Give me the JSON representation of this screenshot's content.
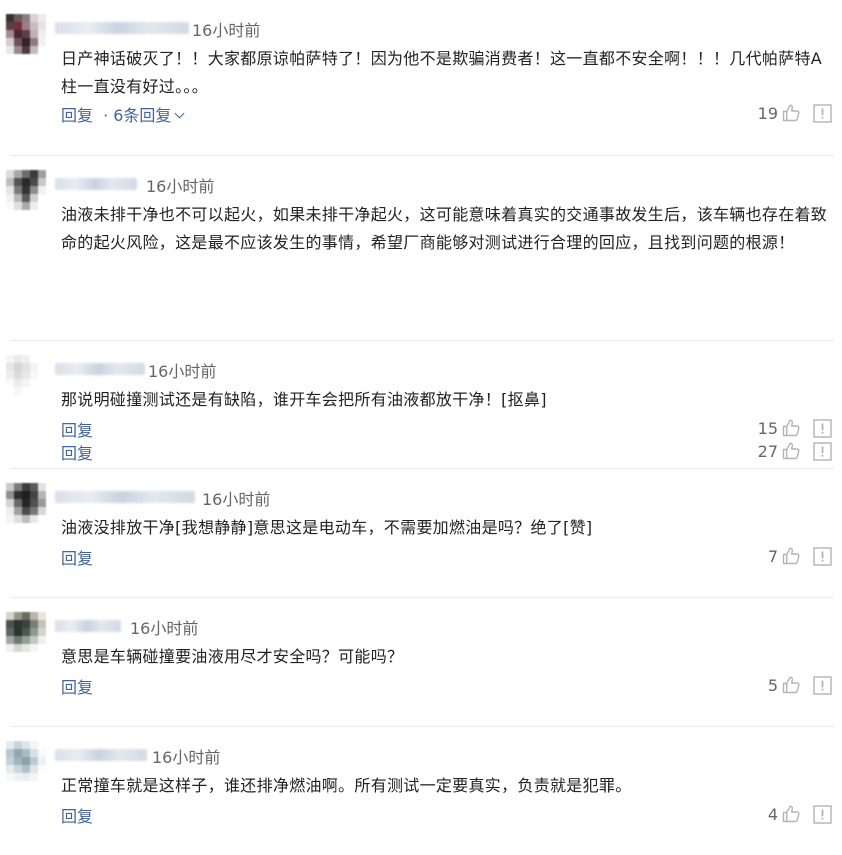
{
  "comments": [
    {
      "time": "16小时前",
      "text": "日产神话破灭了！！大家都原谅帕萨特了！因为他不是欺骗消费者！这一直都不安全啊！！！几代帕萨特A柱一直没有好过。。。",
      "reply_label": "回复",
      "replies_label": "6条回复",
      "likes": "19",
      "avatar_colors": [
        "#3a2f31",
        "#6b5a5e",
        "#8a7d80",
        "#d9d2d3",
        "#efeaeb",
        "#5e3f45",
        "#7b2b3a",
        "#9c7f86",
        "#c7bcc0",
        "#e8e2e4",
        "#a48a91",
        "#4a2830",
        "#5d4149",
        "#bfb2b6",
        "#f1eded",
        "#d8ccd0",
        "#6e5057",
        "#2f2428",
        "#8e7b80",
        "#f4f1f2",
        "#ece6e8",
        "#9b8990",
        "#503b40",
        "#c6b9bd",
        "#ffffff"
      ]
    },
    {
      "time": "16小时前",
      "text": "油液未排干净也不可以起火，如果未排干净起火，这可能意味着真实的交通事故发生后，该车辆也存在着致命的起火风险，这是最不应该发生的事情，希望厂商能够对测试进行合理的回应，且找到问题的根源！",
      "reply_label": "回复",
      "likes": "27",
      "avatar_colors": [
        "#dcdcdc",
        "#a9a9a9",
        "#6d6d6d",
        "#3c3c3c",
        "#9e9e9e",
        "#bdbdbd",
        "#555555",
        "#2a2a2a",
        "#4b4b4b",
        "#c8c8c8",
        "#e4e4e4",
        "#7a7a7a",
        "#333333",
        "#8d8d8d",
        "#f0f0f0",
        "#f2f2f2",
        "#b7b7b7",
        "#5a5a5a",
        "#d0d0d0",
        "#ffffff",
        "#fafafa",
        "#e0e0e0",
        "#aaaaaa",
        "#eeeeee",
        "#ffffff"
      ]
    },
    {
      "time": "16小时前",
      "text": "那说明碰撞测试还是有缺陷，谁开车会把所有油液都放干净！[抠鼻]",
      "reply_label": "回复",
      "likes": "15",
      "avatar_colors": [
        "#f5f5f5",
        "#eaeaea",
        "#f0f0f0",
        "#ffffff",
        "#ffffff",
        "#e6e6e6",
        "#d6d6d6",
        "#e2e2e2",
        "#f3f3f3",
        "#ffffff",
        "#eeeeee",
        "#dcdcdc",
        "#e8e8e8",
        "#f7f7f7",
        "#ffffff",
        "#fafafa",
        "#ececec",
        "#f4f4f4",
        "#ffffff",
        "#ffffff",
        "#ffffff",
        "#f6f6f6",
        "#ffffff",
        "#ffffff",
        "#ffffff"
      ]
    },
    {
      "time": "16小时前",
      "text": "油液没排放干净[我想静静]意思这是电动车，不需要加燃油是吗？绝了[赞]",
      "reply_label": "回复",
      "likes": "7",
      "avatar_colors": [
        "#c9c9c9",
        "#7c7c7c",
        "#3d3d3d",
        "#5b5b5b",
        "#e2e2e2",
        "#8f8f8f",
        "#2e2e2e",
        "#1f1f1f",
        "#444444",
        "#b5b5b5",
        "#d3d3d3",
        "#696969",
        "#262626",
        "#505050",
        "#9a9a9a",
        "#eeeeee",
        "#a0a0a0",
        "#4a4a4a",
        "#777777",
        "#d8d8d8",
        "#f5f5f5",
        "#e0e0e0",
        "#bcbcbc",
        "#e8e8e8",
        "#ffffff"
      ]
    },
    {
      "time": "16小时前",
      "text": "意思是车辆碰撞要油液用尽才安全吗？可能吗？",
      "reply_label": "回复",
      "likes": "5",
      "avatar_colors": [
        "#d7d4cc",
        "#9a9588",
        "#6b6a62",
        "#b9b6ac",
        "#e7e5df",
        "#4f524d",
        "#2f3432",
        "#3d4440",
        "#7b7d76",
        "#c6c3bb",
        "#5d6660",
        "#2c3330",
        "#4a5a52",
        "#8b9a8e",
        "#d3d4ce",
        "#a3a6a0",
        "#6f7a73",
        "#93a097",
        "#c1c7c2",
        "#eef0ec",
        "#efefec",
        "#d4d7d2",
        "#e5e7e3",
        "#f4f5f2",
        "#ffffff"
      ]
    },
    {
      "time": "16小时前",
      "text": "正常撞车就是这样子，谁还排净燃油啊。所有测试一定要真实，负责就是犯罪。",
      "reply_label": "回复",
      "likes": "4",
      "avatar_colors": [
        "#e5ecef",
        "#c9d6dc",
        "#dfe6e9",
        "#f2f5f6",
        "#ffffff",
        "#b7c8cf",
        "#8fa8b2",
        "#a9bcc4",
        "#d7e0e4",
        "#f7f9fa",
        "#c3d1d6",
        "#9fb4bc",
        "#8aa1ab",
        "#bccbd1",
        "#edf1f3",
        "#e4eaed",
        "#cad6db",
        "#b0c2c9",
        "#dde5e8",
        "#fbfcfc",
        "#f6f8f9",
        "#eef2f4",
        "#e8eef0",
        "#f3f6f7",
        "#ffffff"
      ]
    }
  ],
  "colors": {
    "reply_link": "#406599",
    "meta_text": "#666666",
    "body_text": "#222222",
    "icon_gray": "#b4b4b4",
    "divider": "#ececec"
  },
  "icons": {
    "like": "thumbs-up-icon",
    "report": "report-icon",
    "expand": "chevron-down-icon"
  }
}
